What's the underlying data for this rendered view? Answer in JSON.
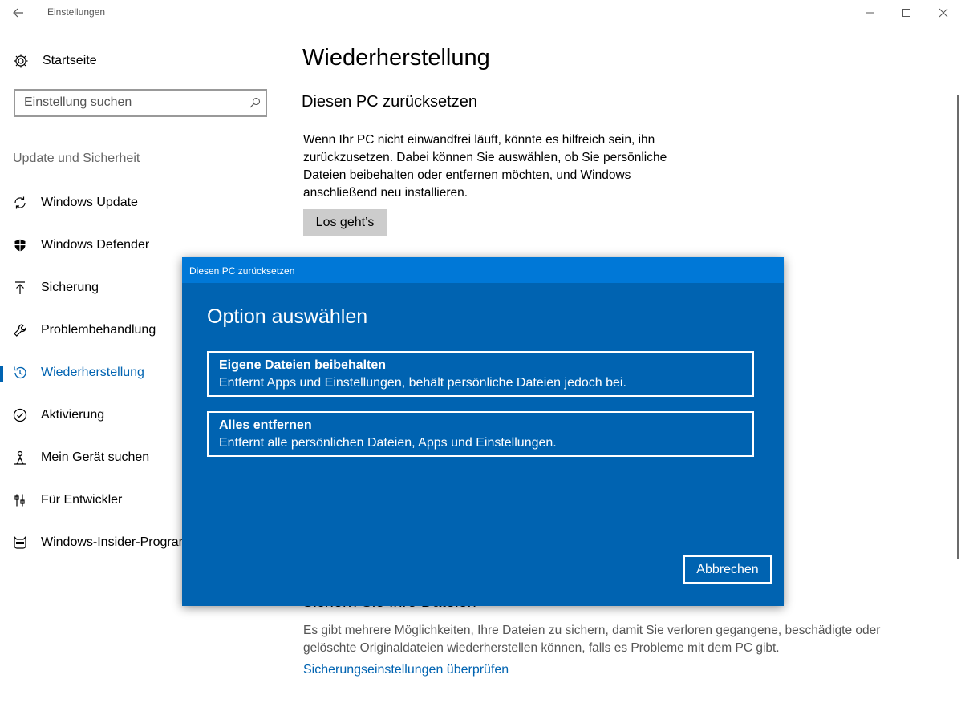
{
  "window": {
    "title": "Einstellungen",
    "back_icon": "arrow-left-icon",
    "minimize_icon": "minimize-icon",
    "maximize_icon": "maximize-icon",
    "close_icon": "close-icon"
  },
  "sidebar": {
    "home_label": "Startseite",
    "search_placeholder": "Einstellung suchen",
    "section_header": "Update und Sicherheit",
    "items": [
      {
        "label": "Windows Update",
        "icon": "sync-icon",
        "active": false
      },
      {
        "label": "Windows Defender",
        "icon": "shield-icon",
        "active": false
      },
      {
        "label": "Sicherung",
        "icon": "upload-icon",
        "active": false
      },
      {
        "label": "Problembehandlung",
        "icon": "wrench-icon",
        "active": false
      },
      {
        "label": "Wiederherstellung",
        "icon": "history-icon",
        "active": true
      },
      {
        "label": "Aktivierung",
        "icon": "check-circle-icon",
        "active": false
      },
      {
        "label": "Mein Gerät suchen",
        "icon": "person-locate-icon",
        "active": false
      },
      {
        "label": "Für Entwickler",
        "icon": "developer-tools-icon",
        "active": false
      },
      {
        "label": "Windows-Insider-Programm",
        "icon": "ninja-cat-icon",
        "active": false
      }
    ]
  },
  "main": {
    "title": "Wiederherstellung",
    "reset_section": {
      "title": "Diesen PC zurücksetzen",
      "description": "Wenn Ihr PC nicht einwandfrei läuft, könnte es hilfreich sein, ihn zurückzusetzen. Dabei können Sie auswählen, ob Sie persönliche Dateien beibehalten oder entfernen möchten, und Windows anschließend neu installieren.",
      "button_label": "Los geht’s"
    },
    "backup_section": {
      "title": "Sichern Sie Ihre Dateien",
      "description": "Es gibt mehrere Möglichkeiten, Ihre Dateien zu sichern, damit Sie verloren gegangene, beschädigte oder gelöschte Originaldateien wiederherstellen können, falls es Probleme mit dem PC gibt.",
      "link_label": "Sicherungseinstellungen überprüfen"
    }
  },
  "dialog": {
    "titlebar": "Diesen PC zurücksetzen",
    "heading": "Option auswählen",
    "options": [
      {
        "title": "Eigene Dateien beibehalten",
        "description": "Entfernt Apps und Einstellungen, behält persönliche Dateien jedoch bei."
      },
      {
        "title": "Alles entfernen",
        "description": "Entfernt alle persönlichen Dateien, Apps und Einstellungen."
      }
    ],
    "cancel_label": "Abbrechen"
  },
  "colors": {
    "accent": "#0063B1",
    "dialog_bg": "#0063B1",
    "dialog_titlebar": "#0078D7"
  }
}
